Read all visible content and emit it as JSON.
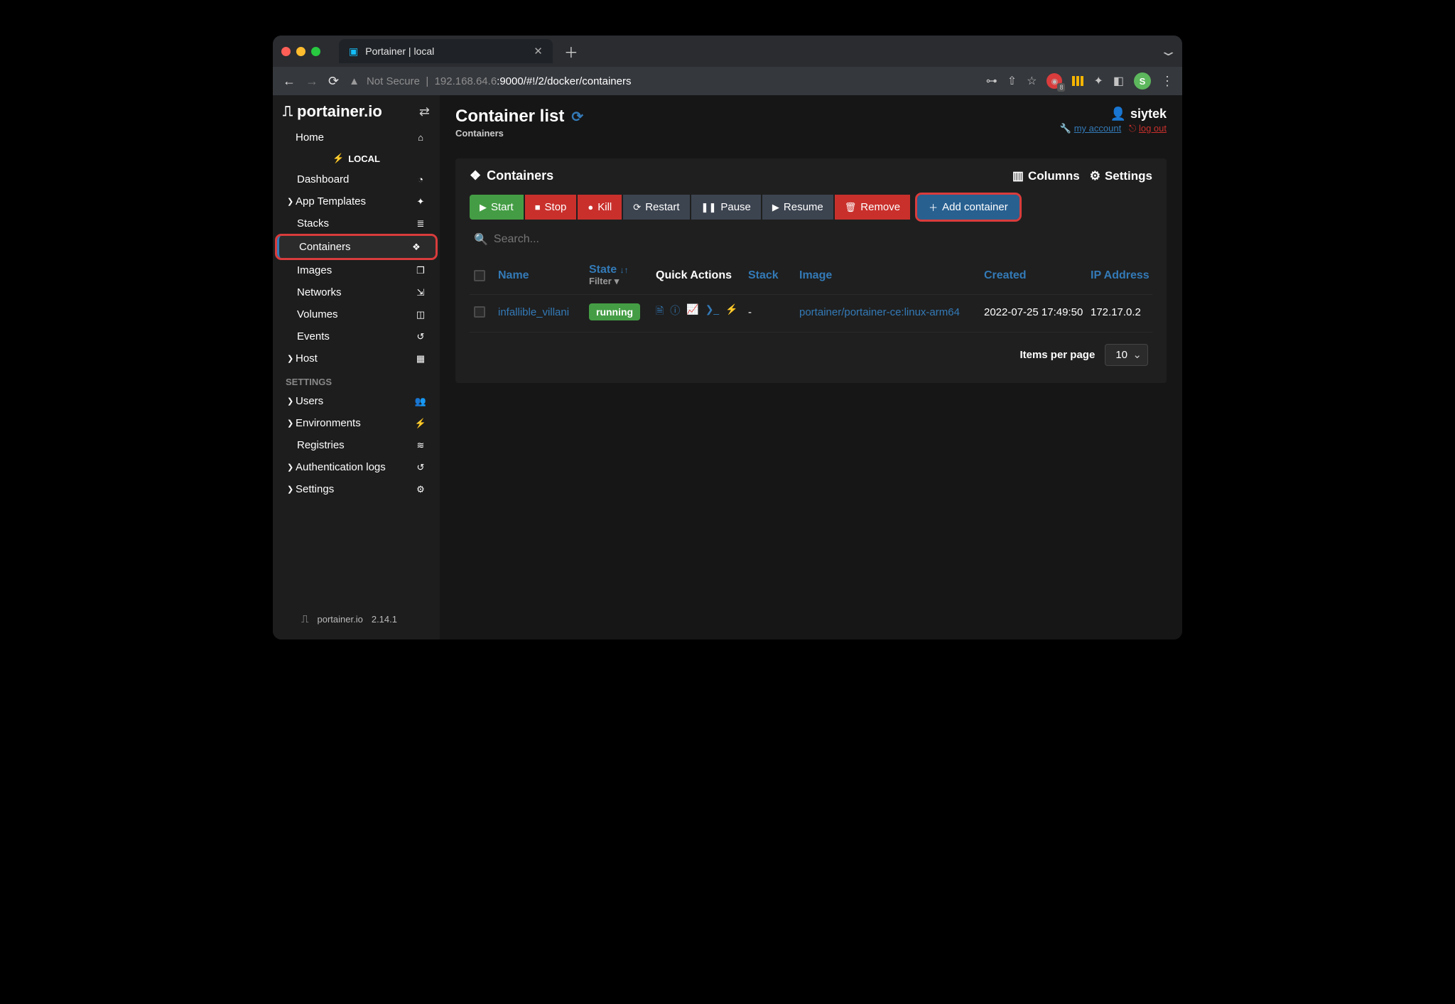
{
  "browser": {
    "tab_title": "Portainer | local",
    "url_prefix": "Not Secure",
    "url_dim1": "192.168.64.6",
    "url_bright": ":9000/#!/2/docker/containers",
    "avatar_letter": "S"
  },
  "sidebar": {
    "brand": "portainer.io",
    "home": "Home",
    "local_label": "LOCAL",
    "dashboard": "Dashboard",
    "app_templates": "App Templates",
    "stacks": "Stacks",
    "containers": "Containers",
    "images": "Images",
    "networks": "Networks",
    "volumes": "Volumes",
    "events": "Events",
    "host": "Host",
    "settings_header": "SETTINGS",
    "users": "Users",
    "environments": "Environments",
    "registries": "Registries",
    "auth_logs": "Authentication logs",
    "settings": "Settings",
    "footer_brand": "portainer.io",
    "footer_version": "2.14.1"
  },
  "header": {
    "title": "Container list",
    "breadcrumb": "Containers",
    "username": "siytek",
    "my_account": "my account",
    "log_out": "log out"
  },
  "panel": {
    "title": "Containers",
    "columns_label": "Columns",
    "settings_label": "Settings"
  },
  "buttons": {
    "start": "Start",
    "stop": "Stop",
    "kill": "Kill",
    "restart": "Restart",
    "pause": "Pause",
    "resume": "Resume",
    "remove": "Remove",
    "add": "Add container"
  },
  "search": {
    "placeholder": "Search..."
  },
  "columns": {
    "name": "Name",
    "state": "State",
    "filter": "Filter",
    "quick_actions": "Quick Actions",
    "stack": "Stack",
    "image": "Image",
    "created": "Created",
    "ip": "IP Address"
  },
  "rows": [
    {
      "name": "infallible_villani",
      "state": "running",
      "stack": "-",
      "image": "portainer/portainer-ce:linux-arm64",
      "created": "2022-07-25 17:49:50",
      "ip": "172.17.0.2"
    }
  ],
  "footer": {
    "items_per_page": "Items per page",
    "per_page_value": "10"
  }
}
